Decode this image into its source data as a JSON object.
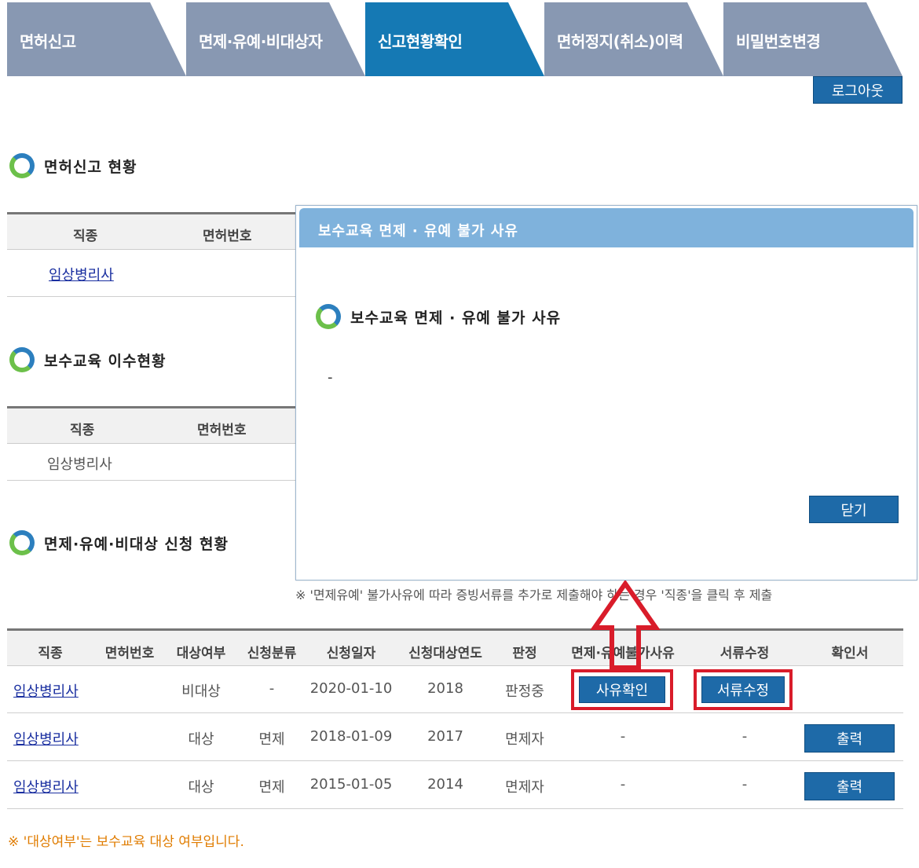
{
  "tabs": [
    {
      "label": "면허신고",
      "active": false
    },
    {
      "label": "면제·유예·비대상자",
      "active": false
    },
    {
      "label": "신고현황확인",
      "active": true
    },
    {
      "label": "면허정지(취소)이력",
      "active": false
    },
    {
      "label": "비밀번호변경",
      "active": false
    }
  ],
  "colors": {
    "tab_inactive": "#8898b2",
    "tab_active": "#1579b4",
    "button": "#1e6aa8",
    "highlight": "#d91c2a",
    "note": "#e07c00"
  },
  "header": {
    "logout_label": "로그아웃"
  },
  "section1": {
    "title": "면허신고 현황",
    "columns": [
      "직종",
      "면허번호"
    ],
    "row": {
      "job": "임상병리사",
      "license": ""
    }
  },
  "section2": {
    "title": "보수교육 이수현황",
    "columns": [
      "직종",
      "면허번호"
    ],
    "row": {
      "job": "임상병리사",
      "license": ""
    }
  },
  "section3": {
    "title": "면제·유예·비대상 신청 현황",
    "note_top": "※ '면제유예' 불가사유에 따라 증빙서류를 추가로 제출해야 하는 경우 '직종'을 클릭 후 제출",
    "columns": [
      "직종",
      "면허번호",
      "대상여부",
      "신청분류",
      "신청일자",
      "신청대상연도",
      "판정",
      "면제·유예불가사유",
      "서류수정",
      "확인서"
    ],
    "rows": [
      {
        "job": "임상병리사",
        "license": "",
        "target": "비대상",
        "category": "-",
        "date": "2020-01-10",
        "year": "2018",
        "decision": "판정중",
        "reason": "사유확인",
        "docs": "서류수정",
        "cert": ""
      },
      {
        "job": "임상병리사",
        "license": "",
        "target": "대상",
        "category": "면제",
        "date": "2018-01-09",
        "year": "2017",
        "decision": "면제자",
        "reason": "-",
        "docs": "-",
        "cert": "출력"
      },
      {
        "job": "임상병리사",
        "license": "",
        "target": "대상",
        "category": "면제",
        "date": "2015-01-05",
        "year": "2014",
        "decision": "면제자",
        "reason": "-",
        "docs": "-",
        "cert": "출력"
      }
    ],
    "note_bottom": "※ '대상여부'는 보수교육 대상 여부입니다."
  },
  "modal": {
    "title": "보수교육 면제 · 유예 불가 사유",
    "heading": "보수교육 면제 · 유예 불가 사유",
    "content": "-",
    "close_label": "닫기"
  }
}
